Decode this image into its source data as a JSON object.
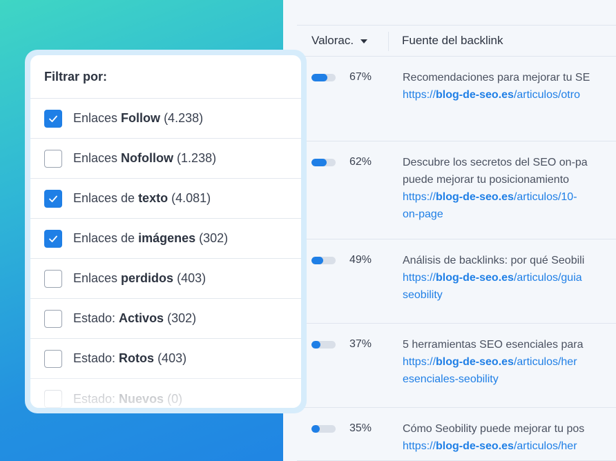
{
  "table": {
    "columns": {
      "score": "Valorac.",
      "source": "Fuente del backlink"
    },
    "rows": [
      {
        "score": 0.67,
        "pct": "67%",
        "title_lines": [
          "Recomendaciones para mejorar tu SE"
        ],
        "url_prefix": "https://",
        "url_domain": "blog-de-seo.es",
        "url_path_lines": [
          "/articulos/otro"
        ]
      },
      {
        "score": 0.62,
        "pct": "62%",
        "title_lines": [
          "Descubre los secretos del SEO on-pa",
          "puede mejorar tu posicionamiento"
        ],
        "url_prefix": "https://",
        "url_domain": "blog-de-seo.es",
        "url_path_lines": [
          "/articulos/10-",
          "on-page"
        ]
      },
      {
        "score": 0.49,
        "pct": "49%",
        "title_lines": [
          "Análisis de backlinks: por qué Seobili"
        ],
        "url_prefix": "https://",
        "url_domain": "blog-de-seo.es",
        "url_path_lines": [
          "/articulos/guia",
          "seobility"
        ]
      },
      {
        "score": 0.37,
        "pct": "37%",
        "title_lines": [
          "5 herramientas SEO esenciales para"
        ],
        "url_prefix": "https://",
        "url_domain": "blog-de-seo.es",
        "url_path_lines": [
          "/articulos/her",
          "esenciales-seobility"
        ]
      },
      {
        "score": 0.35,
        "pct": "35%",
        "title_lines": [
          "Cómo Seobility puede mejorar tu pos"
        ],
        "url_prefix": "https://",
        "url_domain": "blog-de-seo.es",
        "url_path_lines": [
          "/articulos/her"
        ]
      }
    ]
  },
  "filter": {
    "title": "Filtrar por:",
    "options": [
      {
        "checked": true,
        "prefix": "Enlaces ",
        "bold": "Follow",
        "count": "(4.238)"
      },
      {
        "checked": false,
        "prefix": "Enlaces ",
        "bold": "Nofollow",
        "count": "(1.238)"
      },
      {
        "checked": true,
        "prefix": "Enlaces de ",
        "bold": "texto",
        "count": "(4.081)"
      },
      {
        "checked": true,
        "prefix": "Enlaces de ",
        "bold": "imágenes",
        "count": "(302)"
      },
      {
        "checked": false,
        "prefix": "Enlaces ",
        "bold": "perdidos",
        "count": "(403)"
      },
      {
        "checked": false,
        "prefix": "Estado: ",
        "bold": "Activos",
        "count": "(302)"
      },
      {
        "checked": false,
        "prefix": "Estado: ",
        "bold": "Rotos",
        "count": "(403)"
      },
      {
        "checked": false,
        "prefix": "Estado: ",
        "bold": "Nuevos",
        "count": "(0)"
      }
    ]
  },
  "colors": {
    "accent": "#1f7fe6",
    "bar_track": "#d9dfe8",
    "panel_bg": "#f4f7fb"
  },
  "icons": {
    "sort": "caret-down-icon",
    "check": "checkmark-icon"
  }
}
